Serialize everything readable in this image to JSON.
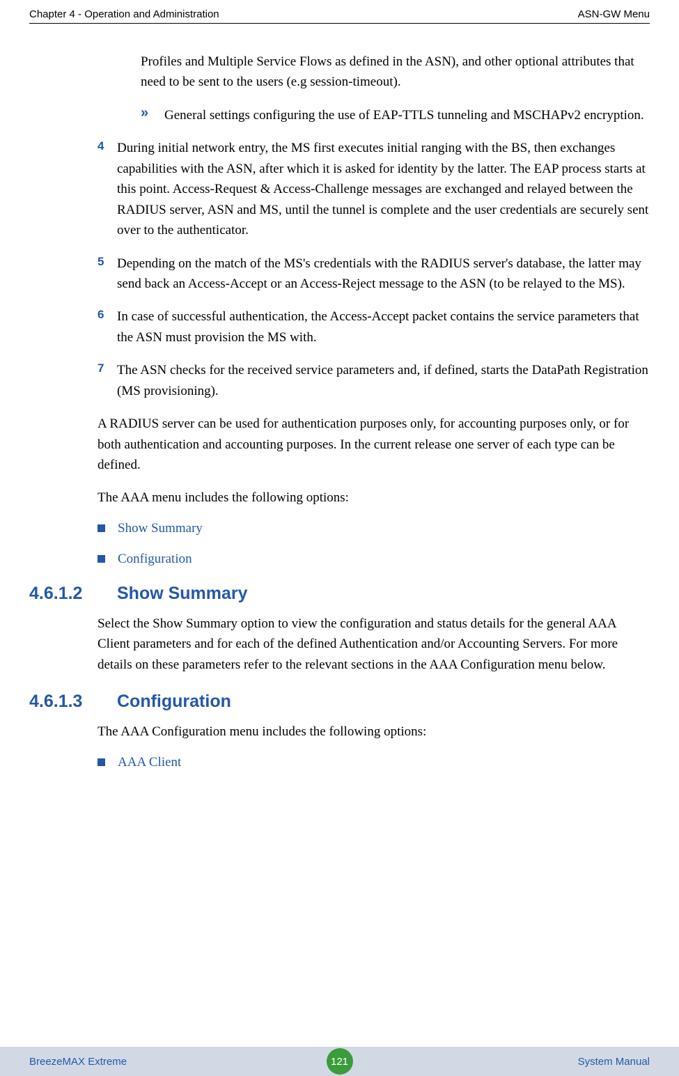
{
  "header": {
    "left": "Chapter 4 - Operation and Administration",
    "right": "ASN-GW Menu"
  },
  "content": {
    "continued_sub": "Profiles and Multiple Service Flows as defined in the ASN), and other optional attributes that need to be sent to the users (e.g session-timeout).",
    "sub_item_general": "General settings configuring the use of EAP-TTLS tunneling and MSCHAPv2 encryption.",
    "item4": {
      "num": "4",
      "text": "During initial network entry, the MS first executes initial ranging with the BS, then exchanges capabilities with the ASN, after which it is asked for identity by the latter. The EAP process starts at this point. Access-Request & Access-Challenge messages are exchanged and relayed between the RADIUS server, ASN and MS, until the tunnel is complete and the user credentials are securely sent over to the authenticator."
    },
    "item5": {
      "num": "5",
      "text": "Depending on the match of the MS's credentials with the RADIUS server's database, the latter may send back an Access-Accept or an Access-Reject message to the ASN (to be relayed to the MS)."
    },
    "item6": {
      "num": "6",
      "text": "In case of successful authentication, the Access-Accept packet contains the service parameters that the ASN must provision the MS with."
    },
    "item7": {
      "num": "7",
      "text": "The ASN checks for the received service parameters and, if defined, starts the DataPath Registration (MS provisioning)."
    },
    "para1": "A RADIUS server can be used for authentication purposes only, for accounting purposes only, or for both authentication and accounting purposes. In the current release one server of each type can be defined.",
    "para2": "The AAA menu includes the following options:",
    "bullet_show": "Show Summary",
    "bullet_config": "Configuration",
    "section_4612": {
      "num": "4.6.1.2",
      "title": "Show Summary",
      "text": "Select the Show Summary option to view the configuration and status details for the general AAA Client parameters and for each of the defined Authentication and/or Accounting Servers. For more details on these parameters refer to the relevant sections in the AAA Configuration menu below."
    },
    "section_4613": {
      "num": "4.6.1.3",
      "title": "Configuration",
      "text": "The AAA Configuration menu includes the following options:"
    },
    "bullet_aaa": "AAA Client"
  },
  "footer": {
    "left": "BreezeMAX Extreme",
    "page": "121",
    "right": "System Manual"
  }
}
